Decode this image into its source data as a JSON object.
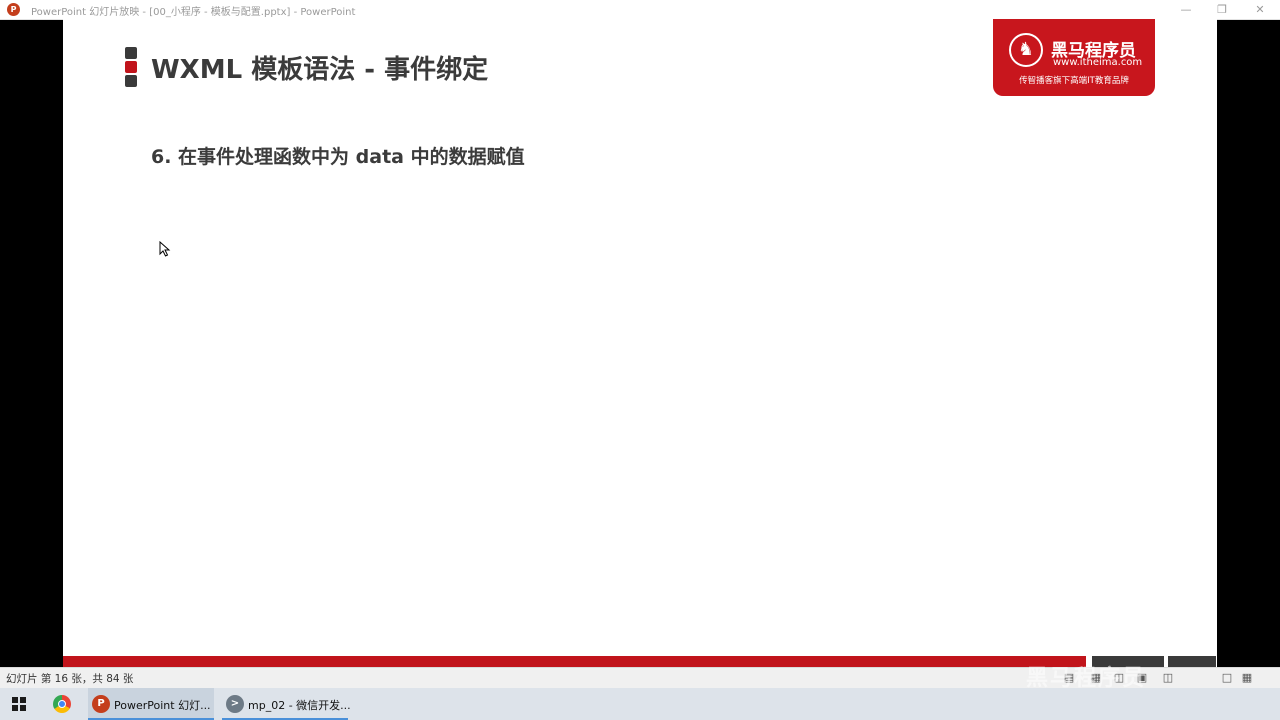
{
  "window": {
    "title": "PowerPoint 幻灯片放映 - [00_小程序 - 模板与配置.pptx] - PowerPoint",
    "app_icon": "P"
  },
  "slide": {
    "title": "WXML 模板语法 - 事件绑定",
    "subtitle": "6. 在事件处理函数中为 data 中的数据赋值",
    "logo": {
      "name": "黑马程序员",
      "url": "www.itheima.com",
      "slogan": "传智播客旗下高端IT教育品牌"
    }
  },
  "statusbar": {
    "slide_counter": "幻灯片 第 16 张，共 84 张",
    "watermark": "黑马程序员"
  },
  "taskbar": {
    "items": [
      {
        "label": "PowerPoint 幻灯...",
        "icon": "P"
      },
      {
        "label": "mp_02 - 微信开发...",
        "icon": ">"
      }
    ]
  },
  "colors": {
    "brand_red": "#c1141b",
    "title_text": "#3b3b3b",
    "dark_gray": "#3a3a3a"
  }
}
